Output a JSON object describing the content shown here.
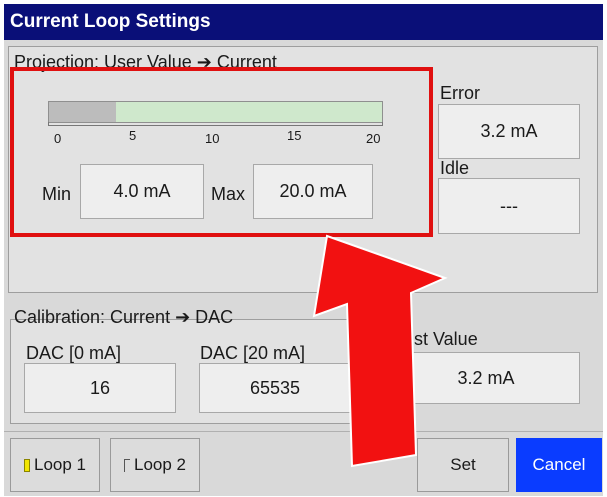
{
  "window": {
    "title": "Current Loop Settings"
  },
  "projection": {
    "title": "Projection: User Value ➔ Current",
    "scale_ticks": [
      "0",
      "5",
      "10",
      "15",
      "20"
    ],
    "scale_range_ma": [
      0,
      20
    ],
    "gray_segment_end_ma": 4.0,
    "min_label": "Min",
    "min_value": "4.0 mA",
    "max_label": "Max",
    "max_value": "20.0 mA"
  },
  "error": {
    "label": "Error",
    "value": "3.2 mA"
  },
  "idle": {
    "label": "Idle",
    "value": "---"
  },
  "calibration": {
    "title": "Calibration: Current ➔ DAC",
    "dac0_label": "DAC [0 mA]",
    "dac0_value": "16",
    "dac20_label": "DAC [20 mA]",
    "dac20_value": "65535"
  },
  "test_value": {
    "label": "st Value",
    "value": "3.2 mA"
  },
  "footer": {
    "loop1_label": "Loop 1",
    "loop2_label": "Loop 2",
    "set_label": "Set",
    "cancel_label": "Cancel"
  },
  "colors": {
    "title_bar": "#0a0f78",
    "scale_gray": "#bcbcbc",
    "scale_green": "#cfe8cc",
    "loop1_indicator": "#f2e600",
    "cancel_button": "#0a3cff",
    "highlight": "#e01010"
  },
  "annotation_icons": [
    "highlight-box",
    "red-arrow-icon"
  ]
}
